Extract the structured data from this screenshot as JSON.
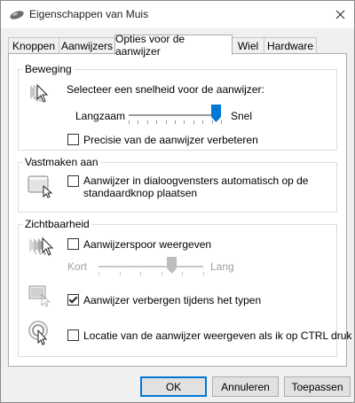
{
  "window": {
    "title": "Eigenschappen van Muis"
  },
  "tabs": [
    {
      "label": "Knoppen"
    },
    {
      "label": "Aanwijzers"
    },
    {
      "label": "Opties voor de aanwijzer",
      "active": true
    },
    {
      "label": "Wiel"
    },
    {
      "label": "Hardware"
    }
  ],
  "motion": {
    "label": "Beweging",
    "prompt": "Selecteer een snelheid voor de aanwijzer:",
    "slow_label": "Langzaam",
    "fast_label": "Snel",
    "speed_level": 0.95,
    "precision_label": "Precisie van de aanwijzer verbeteren",
    "precision_checked": false,
    "icon": "pointer-speed-icon"
  },
  "snap": {
    "label": "Vastmaken aan",
    "option_line1": "Aanwijzer in dialoogvensters automatisch op de",
    "option_line2": "standaardknop plaatsen",
    "checked": false,
    "icon": "snap-to-button-icon"
  },
  "visibility": {
    "label": "Zichtbaarheid",
    "trails_label": "Aanwijzerspoor weergeven",
    "trails_checked": false,
    "short_label": "Kort",
    "long_label": "Lang",
    "trail_level": 0.7,
    "hide_label": "Aanwijzer verbergen tijdens het typen",
    "hide_checked": true,
    "ctrl_label": "Locatie van de aanwijzer weergeven als ik op CTRL druk",
    "ctrl_checked": false
  },
  "buttons": {
    "ok": "OK",
    "cancel": "Annuleren",
    "apply": "Toepassen"
  },
  "colors": {
    "accent": "#0078d7",
    "thumb_disabled": "#bdbdbd"
  }
}
